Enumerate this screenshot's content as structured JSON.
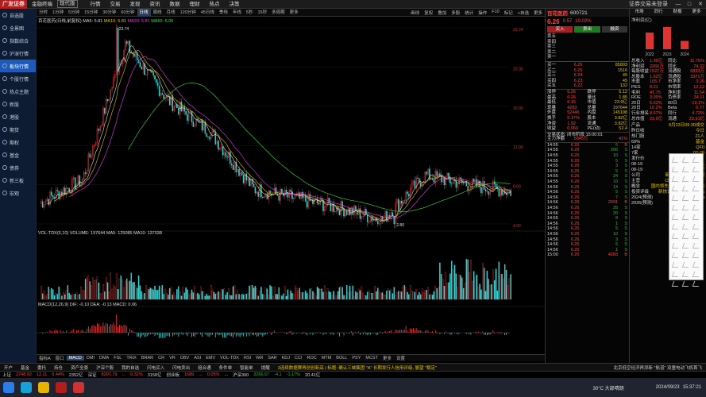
{
  "titlebar": {
    "logo": "广发证券",
    "product": "金融终端",
    "mode": "现代版",
    "menu": [
      "行情",
      "交易",
      "发现",
      "资讯",
      "数据",
      "理财",
      "热点",
      "决策"
    ],
    "login_text": "证券交易未登录",
    "controls": [
      "—",
      "□",
      "✕"
    ]
  },
  "sidebar": {
    "items": [
      {
        "label": "自选股"
      },
      {
        "label": "全景图"
      },
      {
        "label": "指数综合"
      },
      {
        "label": "沪深行情"
      },
      {
        "label": "板块行情"
      },
      {
        "label": "个股行情"
      },
      {
        "label": "热点主题"
      },
      {
        "label": "新股"
      },
      {
        "label": "港股"
      },
      {
        "label": "期货"
      },
      {
        "label": "期权"
      },
      {
        "label": "基金"
      },
      {
        "label": "债券"
      },
      {
        "label": "新三板"
      },
      {
        "label": "宏观"
      }
    ],
    "active_index": 4
  },
  "period_tabs": [
    "分时",
    "1分钟",
    "5分钟",
    "15分钟",
    "30分钟",
    "60分钟",
    "日线",
    "周线",
    "月线",
    "120分钟",
    "45日线",
    "季线",
    "年线",
    "5秒",
    "15秒",
    "多周期",
    "更多"
  ],
  "active_period": "日线",
  "toolbar_right": [
    "画线",
    "复权",
    "叠加",
    "多股",
    "统计",
    "操作",
    "F10",
    "标记",
    "+自选",
    "更多"
  ],
  "chart": {
    "price_info": "百花医药(日线,前复权)",
    "ma5": "MA5: 5.81",
    "ma10": "MA10: 5.81",
    "ma20": "MA20: 5.81",
    "ma60": "MA60: 6.06",
    "high_label": "23.74",
    "low_label": "2.80",
    "vol_info": "VOL-TDX(5,10)  VOLUME: 197644  MA5: 125085  MA10: 137038",
    "macd_info": "MACD(12,26,9)  DIF: -0.10  DEA: -0.13  MACD: 0.06",
    "y_labels": [
      "23.74",
      "20.00",
      "16.00",
      "12.00",
      "8.00",
      "4.00"
    ],
    "x_labels": [
      "2013",
      "2014",
      "2015",
      "2016",
      "2017",
      "2018",
      "2019",
      "2020",
      "2021",
      "2022",
      "2023",
      "2024"
    ]
  },
  "chart_data": {
    "type": "line",
    "title": "百花医药(日线,前复权)",
    "xlabel": "",
    "ylabel": "",
    "x": [
      "2013",
      "2014",
      "2015",
      "2016",
      "2017",
      "2018",
      "2019",
      "2020",
      "2021",
      "2022",
      "2023",
      "2024"
    ],
    "series": [
      {
        "name": "价格",
        "values": [
          5.0,
          7.5,
          22.0,
          16.0,
          12.5,
          6.5,
          5.5,
          4.5,
          3.2,
          8.0,
          7.0,
          6.26
        ]
      }
    ],
    "ylim": [
      2.8,
      23.74
    ]
  },
  "quote": {
    "name": "百花医药",
    "code": "600721",
    "price": "6.26",
    "change": "0.57",
    "pct": "10.02%",
    "tags": [
      "买入",
      "卖出",
      "融资"
    ],
    "sell": [
      {
        "label": "卖五",
        "price": "",
        "vol": ""
      },
      {
        "label": "卖四",
        "price": "",
        "vol": ""
      },
      {
        "label": "卖三",
        "price": "",
        "vol": ""
      },
      {
        "label": "卖二",
        "price": "",
        "vol": ""
      },
      {
        "label": "卖一",
        "price": "",
        "vol": ""
      }
    ],
    "buy": [
      {
        "label": "买一",
        "price": "6.26",
        "vol": "85803"
      },
      {
        "label": "买二",
        "price": "6.25",
        "vol": "1516"
      },
      {
        "label": "买三",
        "price": "6.24",
        "vol": "45"
      },
      {
        "label": "买四",
        "price": "6.23",
        "vol": "45"
      },
      {
        "label": "买五",
        "price": "6.22",
        "vol": "132"
      }
    ],
    "stats": [
      {
        "k": "涨停",
        "v": "6.26",
        "k2": "跌停",
        "v2": "5.12"
      },
      {
        "k": "最高",
        "v": "6.26",
        "k2": "量比",
        "v2": "1.85"
      },
      {
        "k": "最低",
        "v": "6.15",
        "k2": "市值",
        "v2": "23.9亿"
      },
      {
        "k": "现量",
        "v": "4283",
        "k2": "总量",
        "v2": "197644"
      },
      {
        "k": "外盘",
        "v": "52446",
        "k2": "内盘",
        "v2": "145198"
      },
      {
        "k": "换手",
        "v": "5.17%",
        "k2": "股本",
        "v2": "3.82亿"
      },
      {
        "k": "净资",
        "v": "1.92",
        "k2": "流通",
        "v2": "3.82亿"
      },
      {
        "k": "收益",
        "v": "0.060",
        "k2": "PE(动)",
        "v2": "52.4"
      }
    ],
    "trade_status": "交易状态: 闭市阶段 15:00:01",
    "main_flow": "主力净额",
    "main_flow_val": "5045万",
    "main_flow_pct": "41%",
    "ticks": [
      {
        "t": "14:55",
        "p": "6.26",
        "v": "6",
        "s": "B"
      },
      {
        "t": "14:55",
        "p": "6.26",
        "v": "206",
        "s": "S"
      },
      {
        "t": "14:55",
        "p": "6.26",
        "v": "10",
        "s": "S"
      },
      {
        "t": "14:55",
        "p": "6.26",
        "v": "5",
        "s": "S"
      },
      {
        "t": "14:55",
        "p": "6.26",
        "v": "3",
        "s": "S"
      },
      {
        "t": "14:55",
        "p": "6.26",
        "v": "5",
        "s": "S"
      },
      {
        "t": "14:55",
        "p": "6.26",
        "v": "24",
        "s": "S"
      },
      {
        "t": "14:55",
        "p": "6.26",
        "v": "10",
        "s": "S"
      },
      {
        "t": "14:56",
        "p": "6.26",
        "v": "14",
        "s": "S"
      },
      {
        "t": "14:56",
        "p": "6.26",
        "v": "5",
        "s": "S"
      },
      {
        "t": "14:56",
        "p": "6.26",
        "v": "7",
        "s": "S"
      },
      {
        "t": "14:56",
        "p": "6.26",
        "v": "2591",
        "s": "B"
      },
      {
        "t": "14:56",
        "p": "6.26",
        "v": "25",
        "s": "S"
      },
      {
        "t": "14:56",
        "p": "6.26",
        "v": "20",
        "s": "S"
      },
      {
        "t": "14:56",
        "p": "6.26",
        "v": "8",
        "s": "S"
      },
      {
        "t": "14:56",
        "p": "6.26",
        "v": "1",
        "s": "S"
      },
      {
        "t": "14:56",
        "p": "6.26",
        "v": "5",
        "s": "S"
      },
      {
        "t": "14:56",
        "p": "6.26",
        "v": "10",
        "s": "S"
      },
      {
        "t": "14:56",
        "p": "6.26",
        "v": "3",
        "s": "S"
      },
      {
        "t": "14:56",
        "p": "6.26",
        "v": "5",
        "s": "S"
      },
      {
        "t": "14:56",
        "p": "6.26",
        "v": "1",
        "s": "S"
      },
      {
        "t": "15:00",
        "p": "6.26",
        "v": "4283",
        "s": "B"
      }
    ],
    "bottom_tabs": [
      "盘口",
      "指标",
      "笔",
      "价",
      "细",
      "势",
      "联",
      "值",
      "主",
      "更多"
    ]
  },
  "far_right": {
    "tabs": [
      "市场",
      "同行",
      "财报",
      "更多"
    ],
    "profit_title": "净利润(亿)",
    "years": [
      "2022",
      "2023",
      "2024"
    ],
    "bars": [
      0.3,
      0.4,
      0.15
    ],
    "fin": [
      {
        "k": "总收入",
        "v": "1.96亿",
        "k2": "同比",
        "v2": "11.75%"
      },
      {
        "k": "净利润",
        "v": "2266万",
        "k2": "同比",
        "v2": "74.32"
      },
      {
        "k": "每股收益",
        "v": "1527万",
        "k2": "流通股",
        "v2": "6893万"
      },
      {
        "k": "总股本",
        "v": "1.62亿",
        "k2": "流通股",
        "v2": "3371万"
      },
      {
        "k": "市盈",
        "v": "105.7",
        "k2": "市净率",
        "v2": "3.26"
      },
      {
        "k": "PEG",
        "v": "0.21",
        "k2": "市销率",
        "v2": "12.12"
      },
      {
        "k": "毛利",
        "v": "47.75",
        "k2": "净利率",
        "v2": "11.54"
      },
      {
        "k": "ROE",
        "v": "3.09%",
        "k2": "负债率",
        "v2": "34.11"
      },
      {
        "k": "20日",
        "v": "6.63%",
        "k2": "60日",
        "v2": "-19.1%"
      },
      {
        "k": "20日",
        "v": "10.2%",
        "k2": "Beta",
        "v2": "0.77"
      },
      {
        "k": "行业排名",
        "v": "8.67%",
        "k2": "同行",
        "v2": "4.72%"
      },
      {
        "k": "总市值",
        "v": "23.9亿",
        "k2": "流通",
        "v2": "23.91亿"
      }
    ],
    "notes": [
      "产品",
      "9月23日09:30成交",
      "昨日收",
      "今日",
      "热门股",
      "21人",
      "69%",
      "基金",
      "14家",
      "QFII",
      "7家",
      "07-26",
      "发行价",
      "61.7万",
      "08-19",
      "跌幅偏离",
      "08-19",
      "异动类型",
      "公司",
      "新疆百花村医药集团",
      "主营",
      "CRO 研发, 药品生产",
      "概念",
      "国内领先的临床前CRO公司",
      "投资评级",
      "新快讯 主题热 选股策略",
      "2024(预测)",
      "2025(预测)",
      "2026(预测)"
    ]
  },
  "bottom_tabs": [
    "指标A",
    "窗口",
    "MACD",
    "DMI",
    "DMA",
    "FSL",
    "TRIX",
    "BRAR",
    "CR",
    "VR",
    "OBV",
    "ASI",
    "EMV",
    "VOL-TDX",
    "RSI",
    "WR",
    "SAR",
    "KDJ",
    "CCI",
    "ROC",
    "MTM",
    "BOLL",
    "PSY",
    "MCST",
    "更多",
    "设置"
  ],
  "bottom_nav": [
    "关联报价",
    "资金选股",
    "综合选股",
    "相关板块",
    "沪深个股",
    "港股通",
    "多窗",
    "流通",
    "换手"
  ],
  "ticker_tape": [
    "开户",
    "基金",
    "委托",
    "持仓",
    "资产全景",
    "沪深个股",
    "我的自选",
    "闪电买入",
    "闪电卖出",
    "组合通",
    "条件单",
    "智能单",
    "提醒"
  ],
  "ticker_news": "3连续数据赛再创创新高 | 标题: 确认三峡集团 \"A\" 长期发行人信用评级, 展望 \"稳定\"",
  "index_bar": [
    {
      "name": "上证",
      "val": "2748.92",
      "chg": "12.11",
      "pct": "0.44%",
      "amt": "2352亿"
    },
    {
      "name": "深证",
      "val": "8207.79",
      "chg": "...",
      "pct": "0.32%",
      "amt": "3158亿"
    },
    {
      "name": "创业板",
      "val": "1589",
      "chg": "...",
      "pct": "0.05%",
      "amt": "..."
    },
    {
      "name": "沪深300",
      "val": "3256.57",
      "chg": "-4.1",
      "pct": "-1.17%",
      "amt": "20.41亿"
    }
  ],
  "status_right": "北京低空经济再添新 \"航道\"  双童电动飞机首飞",
  "taskbar": {
    "weather": "30°C  大部晴朗",
    "date": "2024/09/23",
    "time": "15:37:21"
  },
  "colors": {
    "up": "#ff4040",
    "down": "#20c020",
    "accent": "#1e5bb8",
    "ma_yellow": "#e6c300",
    "ma_white": "#dddddd",
    "ma_magenta": "#e040e0",
    "ma_green": "#40e040"
  }
}
